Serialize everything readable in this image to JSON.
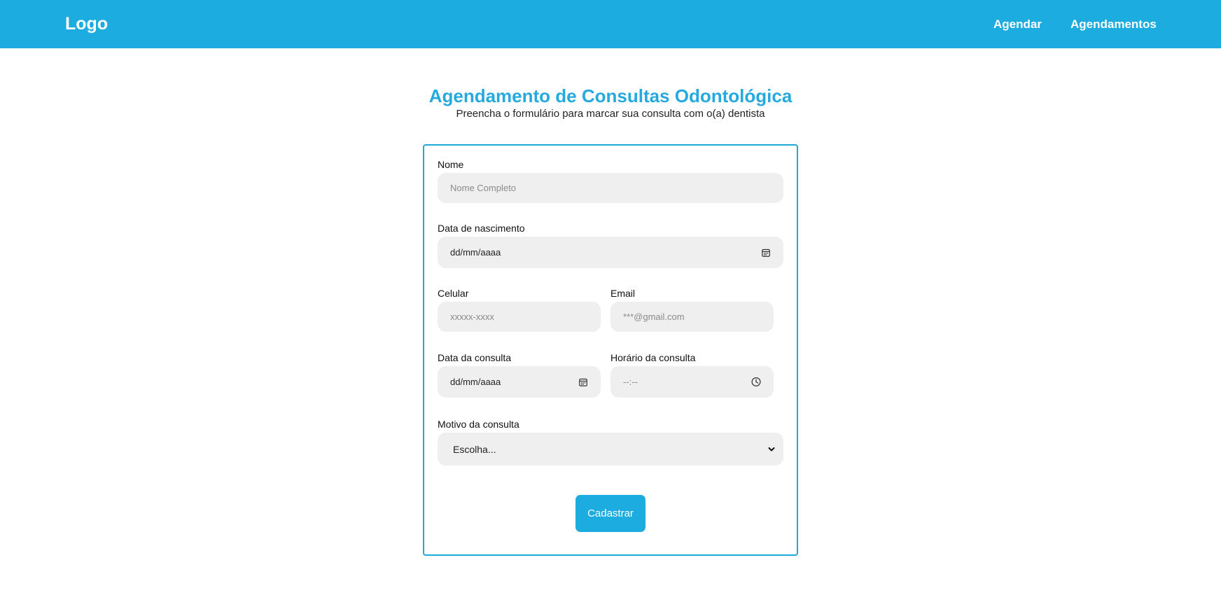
{
  "header": {
    "logo": "Logo",
    "nav": [
      "Agendar",
      "Agendamentos"
    ],
    "background_color": "#1cacdf"
  },
  "page": {
    "title": "Agendamento de Consultas Odontológica",
    "subtitle": "Preencha o formulário para marcar sua consulta com o(a) dentista",
    "title_color": "#26a9df"
  },
  "form": {
    "name": {
      "label": "Nome",
      "placeholder": "Nome Completo"
    },
    "birthdate": {
      "label": "Data de nascimento",
      "placeholder": "dd/mm/aaaa",
      "icon": "calendar-icon"
    },
    "phone": {
      "label": "Celular",
      "placeholder": "xxxxx-xxxx"
    },
    "email": {
      "label": "Email",
      "placeholder": "***@gmail.com"
    },
    "appointment_date": {
      "label": "Data da consulta",
      "placeholder": "dd/mm/aaaa",
      "icon": "calendar-icon"
    },
    "appointment_time": {
      "label": "Horário da consulta",
      "placeholder": "--:--",
      "icon": "clock-icon"
    },
    "reason": {
      "label": "Motivo da consulta",
      "selected": "Escolha...",
      "icon": "chevron-down-icon"
    },
    "submit_label": "Cadastrar"
  }
}
